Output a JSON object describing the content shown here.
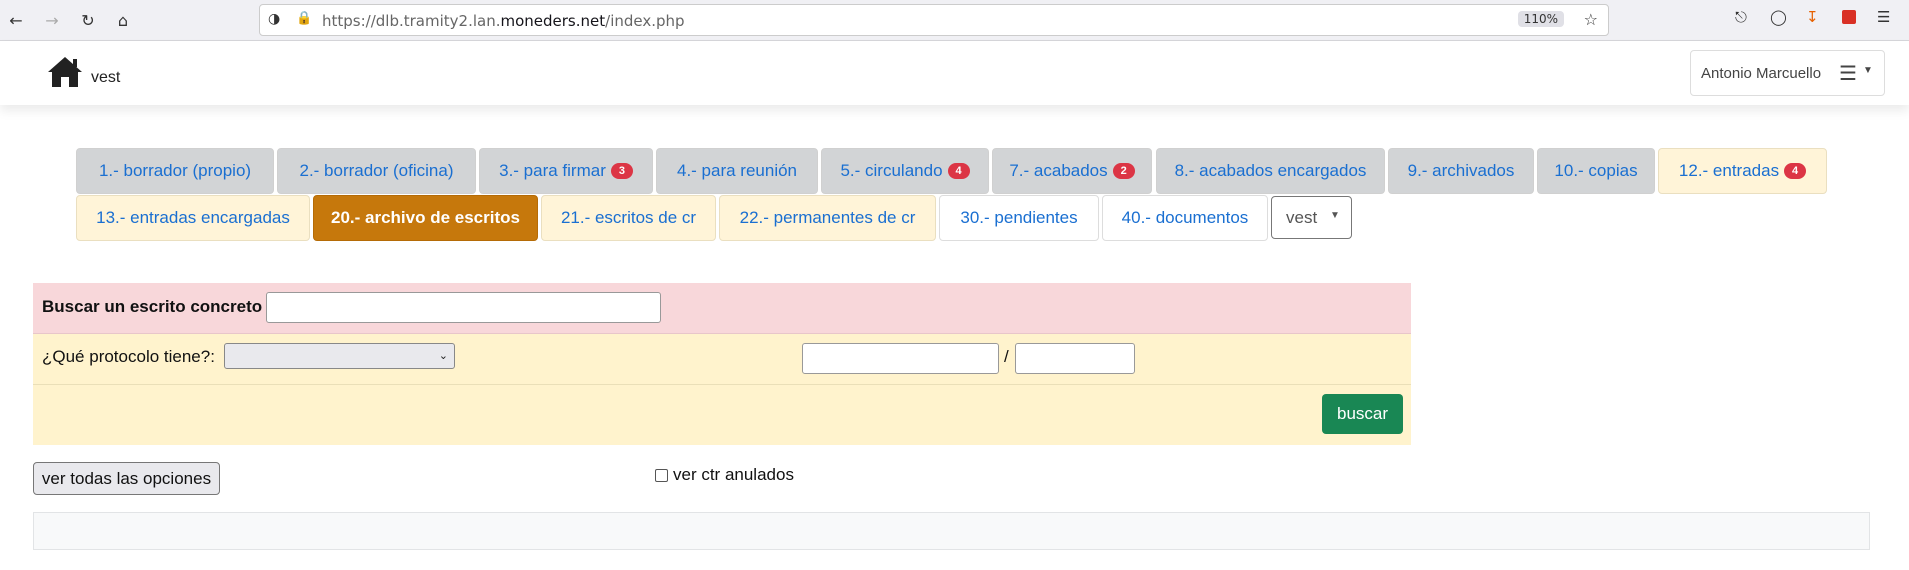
{
  "browser": {
    "url_prefix": "https://dlb.tramity2.lan.",
    "url_domain": "moneders.net",
    "url_path": "/index.php",
    "zoom": "110%"
  },
  "header": {
    "brand": "vest",
    "user_name": "Antonio Marcuello"
  },
  "tabs": [
    {
      "label": "1.- borrador (propio)",
      "badge": ""
    },
    {
      "label": "2.- borrador (oficina)",
      "badge": ""
    },
    {
      "label": "3.- para firmar",
      "badge": "3"
    },
    {
      "label": "4.- para reunión",
      "badge": ""
    },
    {
      "label": "5.- circulando",
      "badge": "4"
    },
    {
      "label": "7.- acabados",
      "badge": "2"
    },
    {
      "label": "8.- acabados encargados",
      "badge": ""
    },
    {
      "label": "9.- archivados",
      "badge": ""
    },
    {
      "label": "10.- copias",
      "badge": ""
    },
    {
      "label": "12.- entradas",
      "badge": "4"
    },
    {
      "label": "13.- entradas encargadas",
      "badge": ""
    },
    {
      "label": "20.- archivo de escritos",
      "badge": ""
    },
    {
      "label": "21.- escritos de cr",
      "badge": ""
    },
    {
      "label": "22.- permanentes de cr",
      "badge": ""
    },
    {
      "label": "30.- pendientes",
      "badge": ""
    },
    {
      "label": "40.- documentos",
      "badge": ""
    }
  ],
  "tab_dropdown": "vest",
  "search": {
    "concrete_label": "Buscar un escrito concreto",
    "concrete_value": "",
    "protocol_label": "¿Qué protocolo tiene?:",
    "protocol_selected": "",
    "protocol_num": "",
    "separator": "/",
    "protocol_year": "",
    "submit_label": "buscar"
  },
  "options_button": "ver todas las opciones",
  "checkbox": {
    "label": "ver ctr anulados",
    "checked": false
  },
  "colors": {
    "active_tab": "#c6780c",
    "link": "#1a6fd1",
    "badge": "#dc3545",
    "search_button": "#198754",
    "row_pink": "#f8d7da",
    "row_cream": "#fff3cd"
  }
}
